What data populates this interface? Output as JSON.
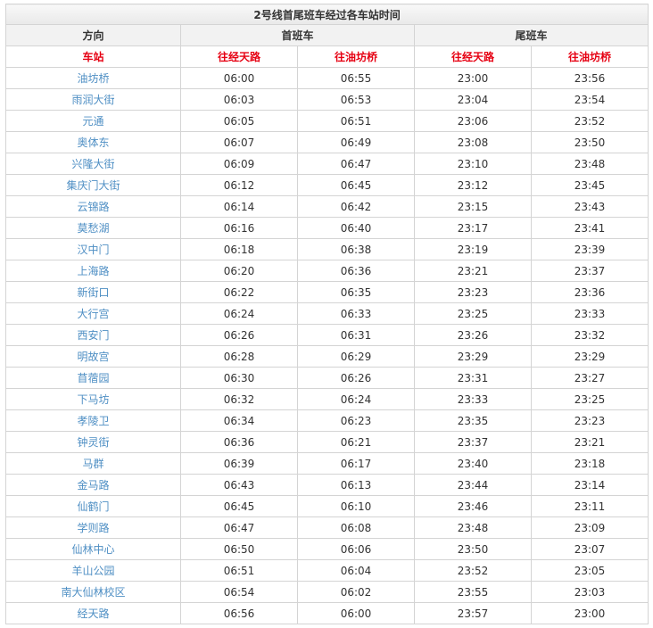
{
  "title": "2号线首尾班车经过各车站时间",
  "header": {
    "direction": "方向",
    "first_train": "首班车",
    "last_train": "尾班车",
    "station": "车站",
    "to_jingtianlu": "往经天路",
    "to_youfangqiao": "往油坊桥"
  },
  "colors": {
    "accent_red": "#e60012",
    "station_blue": "#4f8fc4",
    "border": "#d4d4d4"
  },
  "rows": [
    {
      "station": "油坊桥",
      "first_jtl": "06:00",
      "first_yfq": "06:55",
      "last_jtl": "23:00",
      "last_yfq": "23:56"
    },
    {
      "station": "雨润大街",
      "first_jtl": "06:03",
      "first_yfq": "06:53",
      "last_jtl": "23:04",
      "last_yfq": "23:54"
    },
    {
      "station": "元通",
      "first_jtl": "06:05",
      "first_yfq": "06:51",
      "last_jtl": "23:06",
      "last_yfq": "23:52"
    },
    {
      "station": "奥体东",
      "first_jtl": "06:07",
      "first_yfq": "06:49",
      "last_jtl": "23:08",
      "last_yfq": "23:50"
    },
    {
      "station": "兴隆大街",
      "first_jtl": "06:09",
      "first_yfq": "06:47",
      "last_jtl": "23:10",
      "last_yfq": "23:48"
    },
    {
      "station": "集庆门大街",
      "first_jtl": "06:12",
      "first_yfq": "06:45",
      "last_jtl": "23:12",
      "last_yfq": "23:45"
    },
    {
      "station": "云锦路",
      "first_jtl": "06:14",
      "first_yfq": "06:42",
      "last_jtl": "23:15",
      "last_yfq": "23:43"
    },
    {
      "station": "莫愁湖",
      "first_jtl": "06:16",
      "first_yfq": "06:40",
      "last_jtl": "23:17",
      "last_yfq": "23:41"
    },
    {
      "station": "汉中门",
      "first_jtl": "06:18",
      "first_yfq": "06:38",
      "last_jtl": "23:19",
      "last_yfq": "23:39"
    },
    {
      "station": "上海路",
      "first_jtl": "06:20",
      "first_yfq": "06:36",
      "last_jtl": "23:21",
      "last_yfq": "23:37"
    },
    {
      "station": "新街口",
      "first_jtl": "06:22",
      "first_yfq": "06:35",
      "last_jtl": "23:23",
      "last_yfq": "23:36"
    },
    {
      "station": "大行宫",
      "first_jtl": "06:24",
      "first_yfq": "06:33",
      "last_jtl": "23:25",
      "last_yfq": "23:33"
    },
    {
      "station": "西安门",
      "first_jtl": "06:26",
      "first_yfq": "06:31",
      "last_jtl": "23:26",
      "last_yfq": "23:32"
    },
    {
      "station": "明故宫",
      "first_jtl": "06:28",
      "first_yfq": "06:29",
      "last_jtl": "23:29",
      "last_yfq": "23:29"
    },
    {
      "station": "苜蓿园",
      "first_jtl": "06:30",
      "first_yfq": "06:26",
      "last_jtl": "23:31",
      "last_yfq": "23:27"
    },
    {
      "station": "下马坊",
      "first_jtl": "06:32",
      "first_yfq": "06:24",
      "last_jtl": "23:33",
      "last_yfq": "23:25"
    },
    {
      "station": "孝陵卫",
      "first_jtl": "06:34",
      "first_yfq": "06:23",
      "last_jtl": "23:35",
      "last_yfq": "23:23"
    },
    {
      "station": "钟灵街",
      "first_jtl": "06:36",
      "first_yfq": "06:21",
      "last_jtl": "23:37",
      "last_yfq": "23:21"
    },
    {
      "station": "马群",
      "first_jtl": "06:39",
      "first_yfq": "06:17",
      "last_jtl": "23:40",
      "last_yfq": "23:18"
    },
    {
      "station": "金马路",
      "first_jtl": "06:43",
      "first_yfq": "06:13",
      "last_jtl": "23:44",
      "last_yfq": "23:14"
    },
    {
      "station": "仙鹤门",
      "first_jtl": "06:45",
      "first_yfq": "06:10",
      "last_jtl": "23:46",
      "last_yfq": "23:11"
    },
    {
      "station": "学则路",
      "first_jtl": "06:47",
      "first_yfq": "06:08",
      "last_jtl": "23:48",
      "last_yfq": "23:09"
    },
    {
      "station": "仙林中心",
      "first_jtl": "06:50",
      "first_yfq": "06:06",
      "last_jtl": "23:50",
      "last_yfq": "23:07"
    },
    {
      "station": "羊山公园",
      "first_jtl": "06:51",
      "first_yfq": "06:04",
      "last_jtl": "23:52",
      "last_yfq": "23:05"
    },
    {
      "station": "南大仙林校区",
      "first_jtl": "06:54",
      "first_yfq": "06:02",
      "last_jtl": "23:55",
      "last_yfq": "23:03"
    },
    {
      "station": "经天路",
      "first_jtl": "06:56",
      "first_yfq": "06:00",
      "last_jtl": "23:57",
      "last_yfq": "23:00"
    }
  ]
}
